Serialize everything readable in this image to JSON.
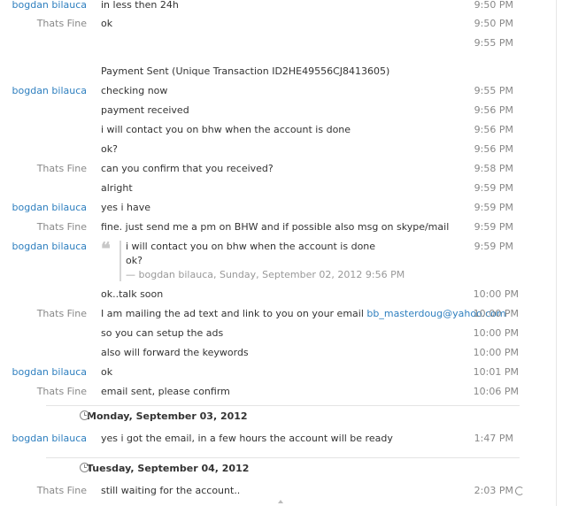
{
  "rows": {
    "r0": {
      "sender": "bogdan bilauca",
      "message": "in less then 24h",
      "time": "9:50 PM"
    },
    "r1": {
      "sender": "Thats Fine",
      "message": "ok",
      "time": "9:50 PM"
    },
    "r2": {
      "time": "9:55 PM"
    },
    "r3": {
      "message": "Payment Sent (Unique Transaction ID2HE49556CJ8413605)"
    },
    "r4": {
      "sender": "bogdan bilauca",
      "message": "checking now",
      "time": "9:55 PM"
    },
    "r5": {
      "message": "payment received",
      "time": "9:56 PM"
    },
    "r6": {
      "message": "i will contact you on bhw when the account is done",
      "time": "9:56 PM"
    },
    "r7": {
      "message": "ok?",
      "time": "9:56 PM"
    },
    "r8": {
      "sender": "Thats Fine",
      "message": "can you confirm that you received?",
      "time": "9:58 PM"
    },
    "r9": {
      "message": "alright",
      "time": "9:59 PM"
    },
    "r10": {
      "sender": "bogdan bilauca",
      "message": "yes i have",
      "time": "9:59 PM"
    },
    "r11": {
      "sender": "Thats Fine",
      "message": "fine. just send me a pm on BHW and if possible also msg on skype/mail",
      "time": "9:59 PM"
    },
    "r12": {
      "sender": "bogdan bilauca",
      "time": "9:59 PM"
    },
    "r13": {
      "message": "ok..talk soon",
      "time": "10:00 PM"
    },
    "r14": {
      "sender": "Thats Fine",
      "message": "I am mailing the ad text and link to you on your email",
      "link": "bb_masterdoug@yahoo.com",
      "time": "10:00 PM"
    },
    "r15": {
      "message": "so you can setup the ads",
      "time": "10:00 PM"
    },
    "r16": {
      "message": "also will forward the keywords",
      "time": "10:00 PM"
    },
    "r17": {
      "sender": "bogdan bilauca",
      "message": "ok",
      "time": "10:01 PM"
    },
    "r18": {
      "sender": "Thats Fine",
      "message": "email sent, please confirm",
      "time": "10:06 PM"
    },
    "r19": {
      "sender": "bogdan bilauca",
      "message": "yes i got the email, in a few hours the account will be ready",
      "time": "1:47 PM"
    },
    "r20": {
      "sender": "Thats Fine",
      "message": "still waiting for the account..",
      "time": "2:03 PM"
    }
  },
  "quote": {
    "line1": "i will contact you on bhw when the account is done",
    "line2": "ok?",
    "attribution": "— bogdan bilauca, Sunday, September 02, 2012 9:56 PM"
  },
  "date_separators": {
    "d1": "Monday, September 03, 2012",
    "d2": "Tuesday, September 04, 2012"
  },
  "colors": {
    "sender_other": "#888888",
    "sender_self": "#2e7fbf",
    "link": "#2e7fbf"
  }
}
